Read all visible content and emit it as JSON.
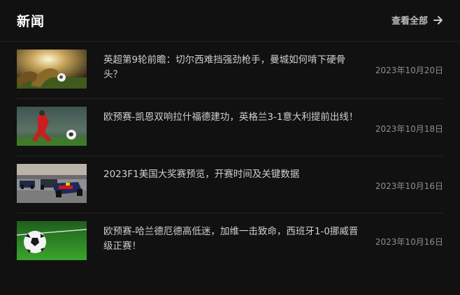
{
  "header": {
    "title": "新闻",
    "view_all_label": "查看全部",
    "view_all_icon": "arrow-right-icon"
  },
  "news": [
    {
      "title": "英超第9轮前瞻：切尔西难挡强劲枪手，曼城如何啃下硬骨头？",
      "date": "2023年10月20日",
      "thumb": "soccer-player-kicking-ball"
    },
    {
      "title": "欧预赛-凯恩双响拉什福德建功，英格兰3-1意大利提前出线！",
      "date": "2023年10月18日",
      "thumb": "soccer-player-red-kit"
    },
    {
      "title": "2023F1美国大奖赛预览，开赛时间及关键数据",
      "date": "2023年10月16日",
      "thumb": "f1-race-cars"
    },
    {
      "title": "欧预赛-哈兰德厄德高低迷，加维一击致命，西班牙1-0挪威晋级正赛！",
      "date": "2023年10月16日",
      "thumb": "soccer-ball-on-grass"
    }
  ],
  "colors": {
    "background": "#111111",
    "divider": "#232323",
    "title": "#ffffff",
    "text": "#cfcfcf",
    "date": "#8e8e8e"
  }
}
